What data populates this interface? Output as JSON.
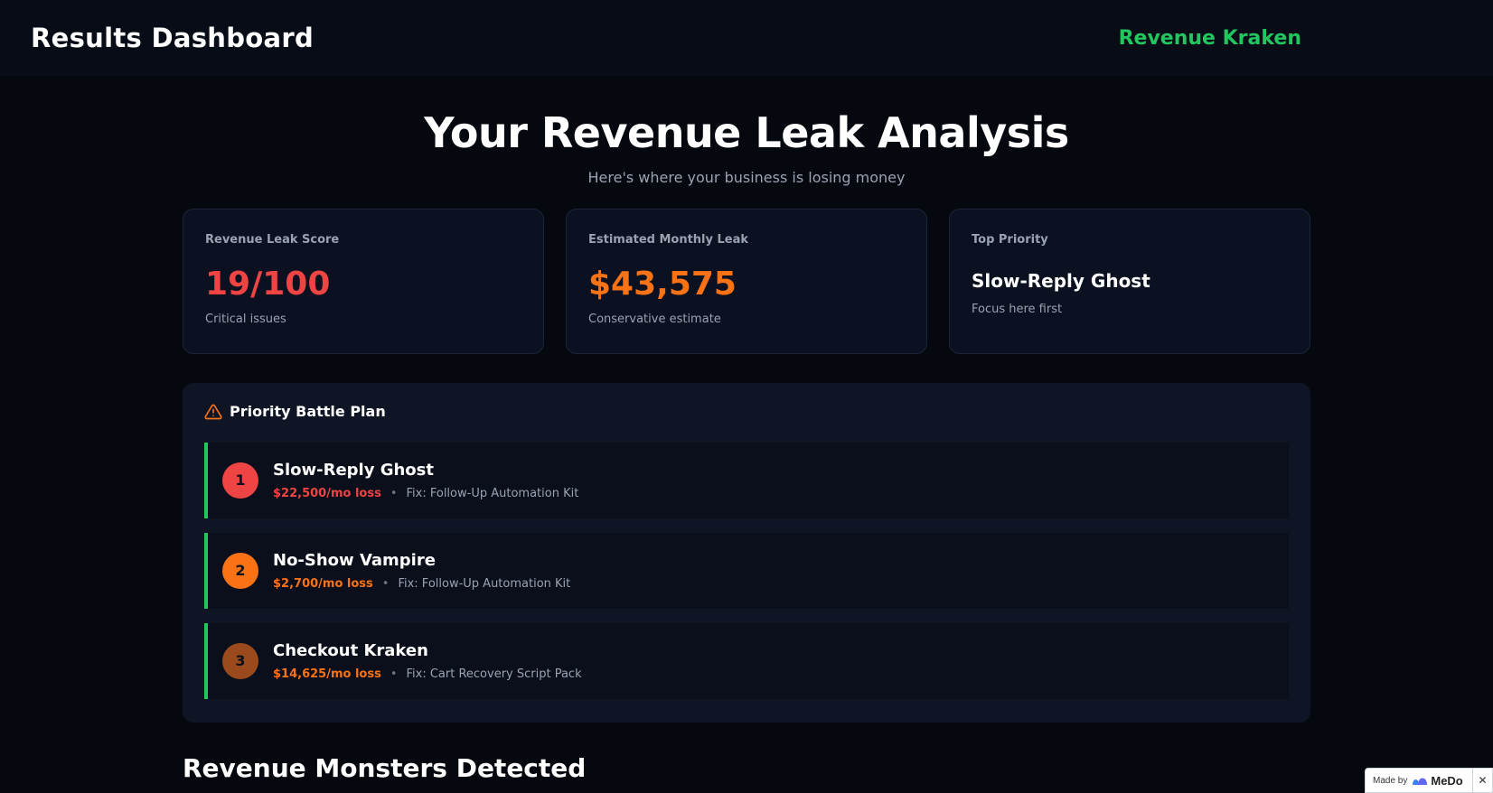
{
  "header": {
    "app_title": "Results Dashboard",
    "brand": "Revenue Kraken"
  },
  "hero": {
    "title": "Your Revenue Leak Analysis",
    "subtitle": "Here's where your business is losing money"
  },
  "stats": [
    {
      "label": "Revenue Leak Score",
      "value": "19/100",
      "note": "Critical issues",
      "color": "#ef4444"
    },
    {
      "label": "Estimated Monthly Leak",
      "value": "$43,575",
      "note": "Conservative estimate",
      "color": "#f97316"
    },
    {
      "label": "Top Priority",
      "value": "Slow-Reply Ghost",
      "note": "Focus here first"
    }
  ],
  "battle_plan": {
    "title": "Priority Battle Plan",
    "icon": "warning-icon",
    "items": [
      {
        "rank": "1",
        "name": "Slow-Reply Ghost",
        "loss": "$22,500/mo loss",
        "separator": "•",
        "fix": "Fix: Follow-Up Automation Kit",
        "badge_color": "#ef4444",
        "loss_color": "#ef4444"
      },
      {
        "rank": "2",
        "name": "No-Show Vampire",
        "loss": "$2,700/mo loss",
        "separator": "•",
        "fix": "Fix: Follow-Up Automation Kit",
        "badge_color": "#f97316",
        "loss_color": "#f97316"
      },
      {
        "rank": "3",
        "name": "Checkout Kraken",
        "loss": "$14,625/mo loss",
        "separator": "•",
        "fix": "Fix: Cart Recovery Script Pack",
        "badge_color": "#9a4a1c",
        "loss_color": "#f97316"
      }
    ]
  },
  "monsters": {
    "title": "Revenue Monsters Detected"
  },
  "badge": {
    "made_by": "Made by",
    "name": "MeDo",
    "close": "✕"
  },
  "colors": {
    "accent_green": "#22c55e",
    "danger_red": "#ef4444",
    "warning_orange": "#f97316"
  }
}
